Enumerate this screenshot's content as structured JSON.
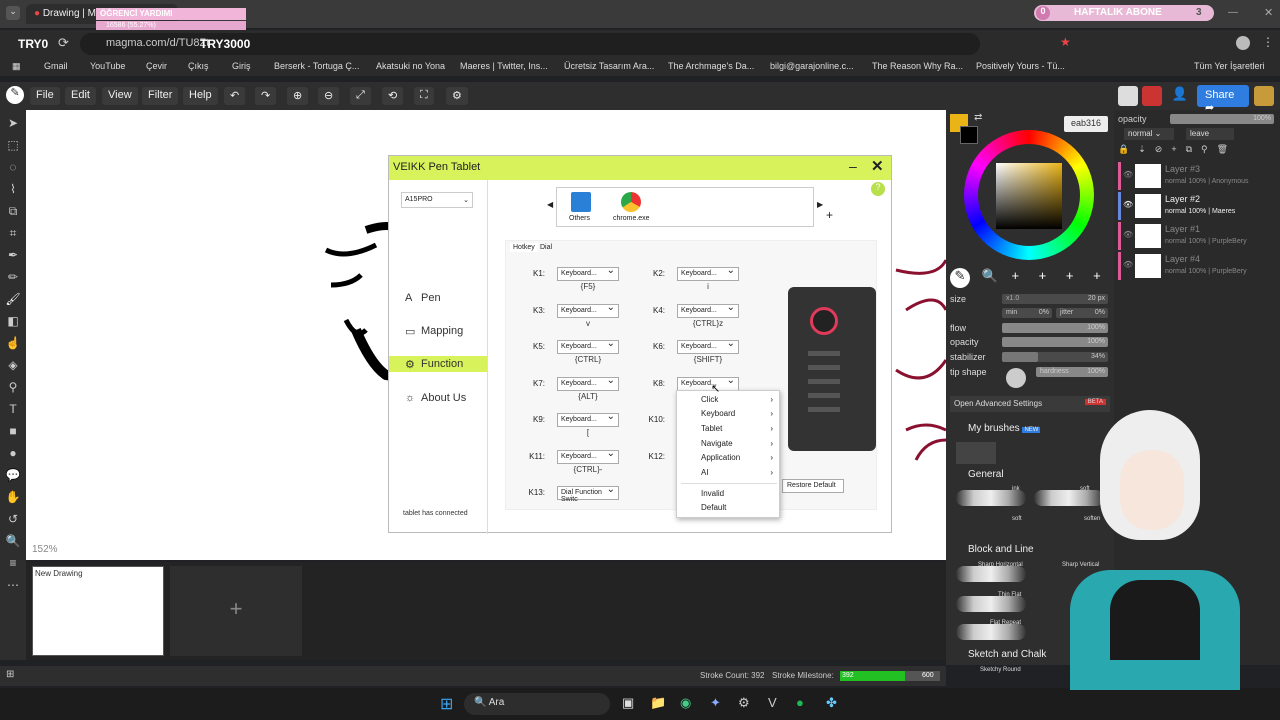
{
  "browser": {
    "tab_title": "Drawing | Magma",
    "tab_overlay": "ÖĞRENCİ YARDIMI",
    "tab_progress": "16586 (55.27%)",
    "url": "magma.com/d/TU8Zt",
    "overlay_left": "TRY0",
    "overlay_right": "TRY3000",
    "sub_label": "HAFTALIK ABONE",
    "sub_count": "3",
    "sub_zero": "0",
    "bookmarks": [
      "Gmail",
      "YouTube",
      "Çevir",
      "Çıkış",
      "Giriş",
      "Berserk - Tortuga Ç...",
      "Akatsuki no Yona",
      "Maeres | Twitter, Ins...",
      "Ücretsiz Tasarım Ara...",
      "The Archmage's Da...",
      "bilgi@garajonline.c...",
      "The Reason Why Ra...",
      "Positively Yours - Tü..."
    ],
    "bookmarks_all": "Tüm Yer İşaretleri"
  },
  "app": {
    "menu": [
      "File",
      "Edit",
      "View",
      "Filter",
      "Help"
    ],
    "share": "Share",
    "zoom": "152%",
    "color_hex": "eab316",
    "stroke_count": "Stroke Count: 392",
    "stroke_milestone_label": "Stroke Milestone:",
    "milestone_value": "392",
    "milestone_max": "600",
    "milestone_fraction": 0.65,
    "doc_name": "New Drawing"
  },
  "layers_panel": {
    "opacity_label": "opacity",
    "opacity_value": "100%",
    "blend": "normal",
    "leave": "leave",
    "layers": [
      {
        "name": "Layer #3",
        "meta": "normal 100% | Anonymous",
        "active": false
      },
      {
        "name": "Layer #2",
        "meta": "normal 100% | Maeres",
        "active": true
      },
      {
        "name": "Layer #1",
        "meta": "normal 100% | PurpleBery",
        "active": false
      },
      {
        "name": "Layer #4",
        "meta": "normal 100% | PurpleBery",
        "active": false
      }
    ]
  },
  "brush": {
    "size_label": "size",
    "size_min": "x1.0",
    "size_val": "20 px",
    "min_label": "min",
    "min_val": "0%",
    "jitter_label": "jitter",
    "jitter_val": "0%",
    "flow_label": "flow",
    "flow_val": "100%",
    "opacity_label": "opacity",
    "opacity_val": "100%",
    "stabilizer_label": "stabilizer",
    "stabilizer_val": "34%",
    "stabilizer_fraction": 0.34,
    "tip_label": "tip shape",
    "hardness_label": "hardness",
    "hardness_val": "100%",
    "advanced": "Open Advanced Settings",
    "beta": "BETA",
    "my_brushes": "My brushes",
    "new_badge": "NEW",
    "general": "General",
    "block_line": "Block and Line",
    "sketch_chalk": "Sketch and Chalk",
    "brush_names": [
      "ink",
      "soft",
      "soft",
      "soften",
      "Sharp Horizontal",
      "Sharp Vertical",
      "Thin Flat",
      "Flat Repeat",
      "Sketchy Round"
    ]
  },
  "veikk": {
    "title": "VEIKK Pen Tablet",
    "model": "A15PRO",
    "apps": [
      "Others",
      "chrome.exe"
    ],
    "nav": [
      "Pen",
      "Mapping",
      "Function",
      "About Us"
    ],
    "tabs": [
      "Hotkey",
      "Dial"
    ],
    "status": "tablet has connected",
    "restore": "Restore Default",
    "keys": [
      {
        "k": "K1:",
        "sel": "Keyboard...",
        "val": "{F5}"
      },
      {
        "k": "K2:",
        "sel": "Keyboard...",
        "val": "i"
      },
      {
        "k": "K3:",
        "sel": "Keyboard...",
        "val": "v"
      },
      {
        "k": "K4:",
        "sel": "Keyboard...",
        "val": "{CTRL}z"
      },
      {
        "k": "K5:",
        "sel": "Keyboard...",
        "val": "{CTRL}"
      },
      {
        "k": "K6:",
        "sel": "Keyboard...",
        "val": "{SHIFT}"
      },
      {
        "k": "K7:",
        "sel": "Keyboard...",
        "val": "{ALT}"
      },
      {
        "k": "K8:",
        "sel": "Keyboard...",
        "val": ""
      },
      {
        "k": "K9:",
        "sel": "Keyboard...",
        "val": "["
      },
      {
        "k": "K10:",
        "sel": "",
        "val": ""
      },
      {
        "k": "K11:",
        "sel": "Keyboard...",
        "val": "{CTRL}-"
      },
      {
        "k": "K12:",
        "sel": "",
        "val": ""
      },
      {
        "k": "K13:",
        "sel": "Dial Function Switc",
        "val": ""
      }
    ],
    "context_menu": [
      "Click",
      "Keyboard",
      "Tablet",
      "Navigate",
      "Application",
      "AI",
      "Invalid",
      "Default"
    ]
  },
  "taskbar": {
    "search": "Ara"
  }
}
